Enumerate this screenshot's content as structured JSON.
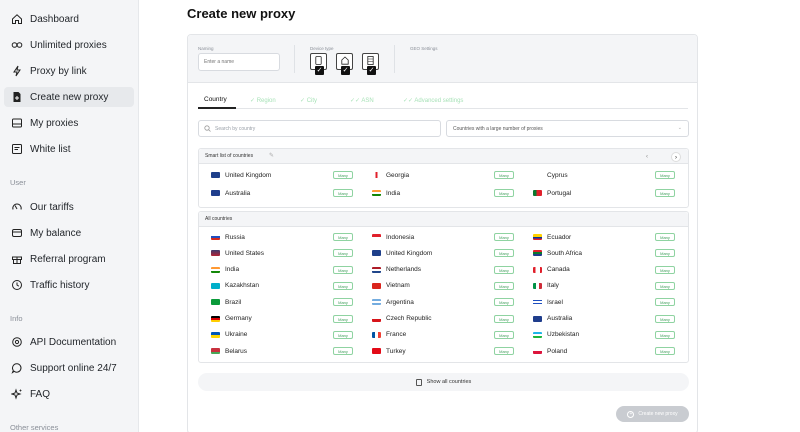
{
  "sidebar": {
    "items": [
      {
        "label": "Dashboard",
        "icon": "home-icon"
      },
      {
        "label": "Unlimited proxies",
        "icon": "infinity-icon"
      },
      {
        "label": "Proxy by link",
        "icon": "bolt-icon"
      },
      {
        "label": "Create new proxy",
        "icon": "file-plus-icon",
        "active": true
      },
      {
        "label": "My proxies",
        "icon": "drive-icon"
      },
      {
        "label": "White list",
        "icon": "list-icon"
      }
    ],
    "section_user": "User",
    "user_items": [
      {
        "label": "Our tariffs",
        "icon": "gauge-icon"
      },
      {
        "label": "My balance",
        "icon": "wallet-icon"
      },
      {
        "label": "Referral program",
        "icon": "gift-icon"
      },
      {
        "label": "Traffic history",
        "icon": "clock-icon"
      }
    ],
    "section_info": "Info",
    "info_items": [
      {
        "label": "API Documentation",
        "icon": "api-icon"
      },
      {
        "label": "Support online 24/7",
        "icon": "chat-icon"
      },
      {
        "label": "FAQ",
        "icon": "sparkle-icon"
      }
    ],
    "section_other": "Other services"
  },
  "page": {
    "title": "Create new proxy"
  },
  "settings": {
    "naming_label": "Naming",
    "naming_placeholder": "Enter a name",
    "device_label": "Device type",
    "geo_label": "GEO Settings"
  },
  "tabs": [
    "Country",
    "Region",
    "City",
    "ASN",
    "Advanced settings"
  ],
  "search": {
    "placeholder": "Search by country"
  },
  "filter": {
    "value": "Countries with a large number of proxies"
  },
  "smart_list": {
    "title": "Smart list of countries",
    "countries": [
      "United Kingdom",
      "Georgia",
      "Cyprus",
      "Australia",
      "India",
      "Portugal"
    ]
  },
  "all_countries": {
    "title": "All countries",
    "countries": [
      "Russia",
      "Indonesia",
      "Ecuador",
      "United States",
      "United Kingdom",
      "South Africa",
      "India",
      "Netherlands",
      "Canada",
      "Kazakhstan",
      "Vietnam",
      "Italy",
      "Brazil",
      "Argentina",
      "Israel",
      "Germany",
      "Czech Republic",
      "Australia",
      "Ukraine",
      "France",
      "Uzbekistan",
      "Belarus",
      "Turkey",
      "Poland"
    ]
  },
  "badge_label": "Many",
  "show_all_label": "Show all countries",
  "create_button_label": "Create new proxy",
  "colors": {
    "accent_green": "#3f9d5a",
    "badge_border": "#8fd3a1",
    "sidebar_bg": "#f4f5f7"
  }
}
